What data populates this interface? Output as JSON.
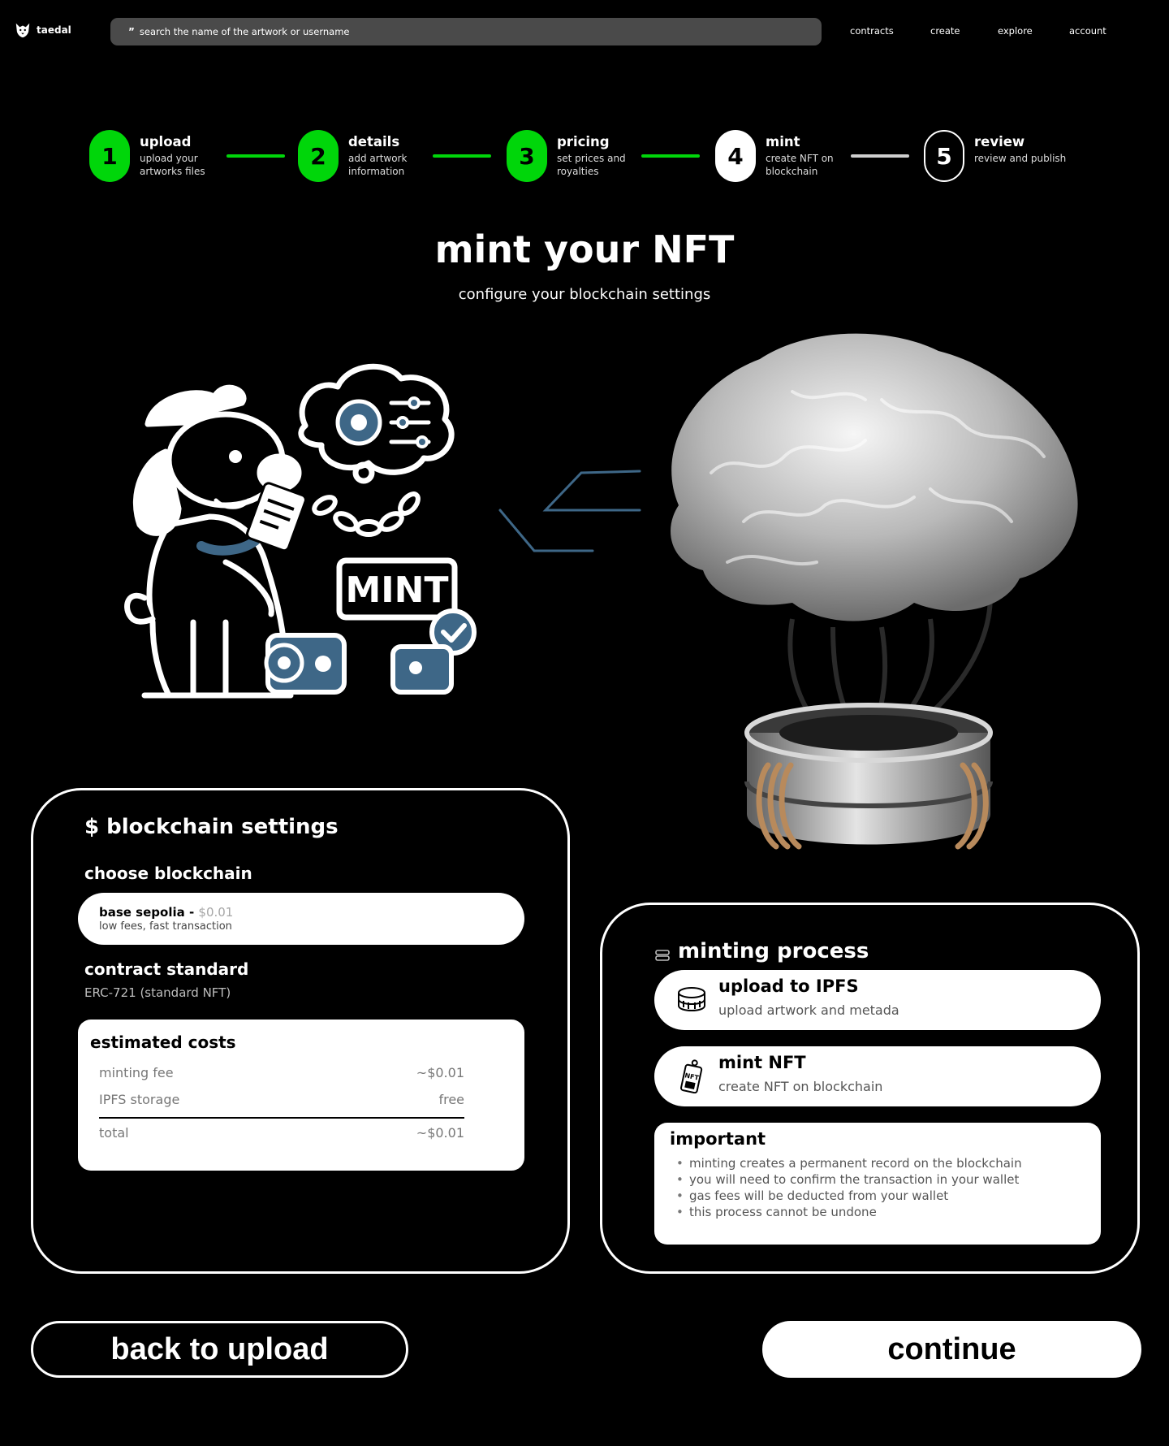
{
  "nav": {
    "brand": "taedal",
    "logo_icon": "wolf-head-icon",
    "search_placeholder": "search the name of the artwork or username",
    "search_glyph": "”",
    "links": [
      "contracts",
      "create",
      "explore",
      "account"
    ]
  },
  "stepper": {
    "steps": [
      {
        "number": "1",
        "title": "upload",
        "desc": "upload your artworks files",
        "state": "done"
      },
      {
        "number": "2",
        "title": "details",
        "desc": "add artwork information",
        "state": "done"
      },
      {
        "number": "3",
        "title": "pricing",
        "desc": "set prices and royalties",
        "state": "done"
      },
      {
        "number": "4",
        "title": "mint",
        "desc": "create NFT on blockchain",
        "state": "current"
      },
      {
        "number": "5",
        "title": "review",
        "desc": "review and publish",
        "state": "todo"
      }
    ],
    "colors": {
      "done": "#00d60a",
      "current": "#ffffff",
      "pending_line": "#cfcfcf"
    }
  },
  "header": {
    "title": "mint your NFT",
    "subtitle": "configure your blockchain settings"
  },
  "illustration": {
    "mint_label": "MINT",
    "dog_icon": "dog-artist-illustration",
    "brain_icon": "glass-brain-illustration"
  },
  "blockchain_settings": {
    "heading": "$ blockchain settings",
    "choose_label": "choose blockchain",
    "selected_chain": {
      "name": "base sepolia",
      "separator": " - ",
      "price": "$0.01",
      "desc": "low fees, fast transaction"
    },
    "contract_label": "contract standard",
    "contract_value": "ERC-721 (standard NFT)",
    "costs": {
      "title": "estimated costs",
      "rows": [
        {
          "label": "minting fee",
          "value": "~$0.01"
        },
        {
          "label": "IPFS storage",
          "value": "free"
        }
      ],
      "total": {
        "label": "total",
        "value": "~$0.01"
      }
    }
  },
  "minting_process": {
    "heading": "minting process",
    "heading_icon": "server-stack-icon",
    "items": [
      {
        "title": "upload to IPFS",
        "desc": "upload artwork and metada",
        "icon": "storage-disk-icon"
      },
      {
        "title": "mint NFT",
        "desc": "create NFT on blockchain",
        "icon": "nft-tag-icon"
      }
    ],
    "important": {
      "title": "important",
      "points": [
        "minting creates a permanent record on the blockchain",
        "you will need to confirm the transaction in your wallet",
        "gas fees will be deducted from your wallet",
        "this process cannot be undone"
      ]
    }
  },
  "actions": {
    "back": "back to upload",
    "continue": "continue"
  }
}
